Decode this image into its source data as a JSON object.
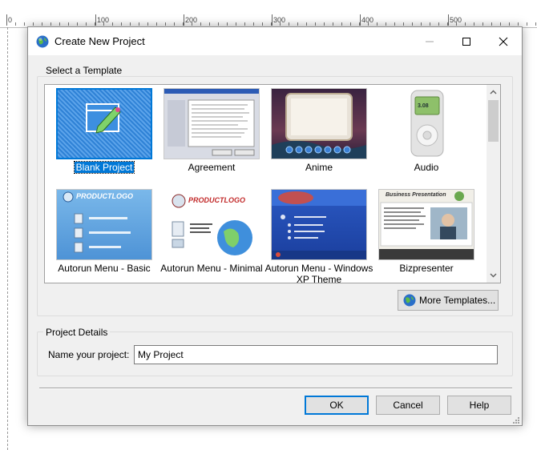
{
  "ruler": {
    "marks": [
      "0",
      "100",
      "200",
      "300",
      "400",
      "500"
    ]
  },
  "dialog": {
    "title": "Create New Project",
    "icons": {
      "app": "globe-icon",
      "minimize": "minimize-icon",
      "maximize": "maximize-icon",
      "close": "close-icon"
    }
  },
  "templates": {
    "group_label": "Select a Template",
    "selected": "Blank Project",
    "items": [
      {
        "label": "Blank Project",
        "selected": true
      },
      {
        "label": "Agreement",
        "selected": false
      },
      {
        "label": "Anime",
        "selected": false
      },
      {
        "label": "Audio",
        "selected": false
      },
      {
        "label": "Autorun Menu - Basic",
        "selected": false
      },
      {
        "label": "Autorun Menu - Minimal",
        "selected": false
      },
      {
        "label": "Autorun Menu - Windows XP Theme",
        "selected": false
      },
      {
        "label": "Bizpresenter",
        "selected": false
      }
    ],
    "thumb_text": {
      "product_logo": "PRODUCTLOGO",
      "audio_display": "3.08",
      "biz_heading": "Business Presentation"
    },
    "more_button": "More Templates...",
    "more_icon": "globe-icon"
  },
  "details": {
    "group_label": "Project Details",
    "name_label": "Name your project:",
    "name_value": "My Project"
  },
  "buttons": {
    "ok": "OK",
    "cancel": "Cancel",
    "help": "Help"
  },
  "colors": {
    "selection": "#0078d7",
    "dialog_bg": "#f0f0f0"
  }
}
